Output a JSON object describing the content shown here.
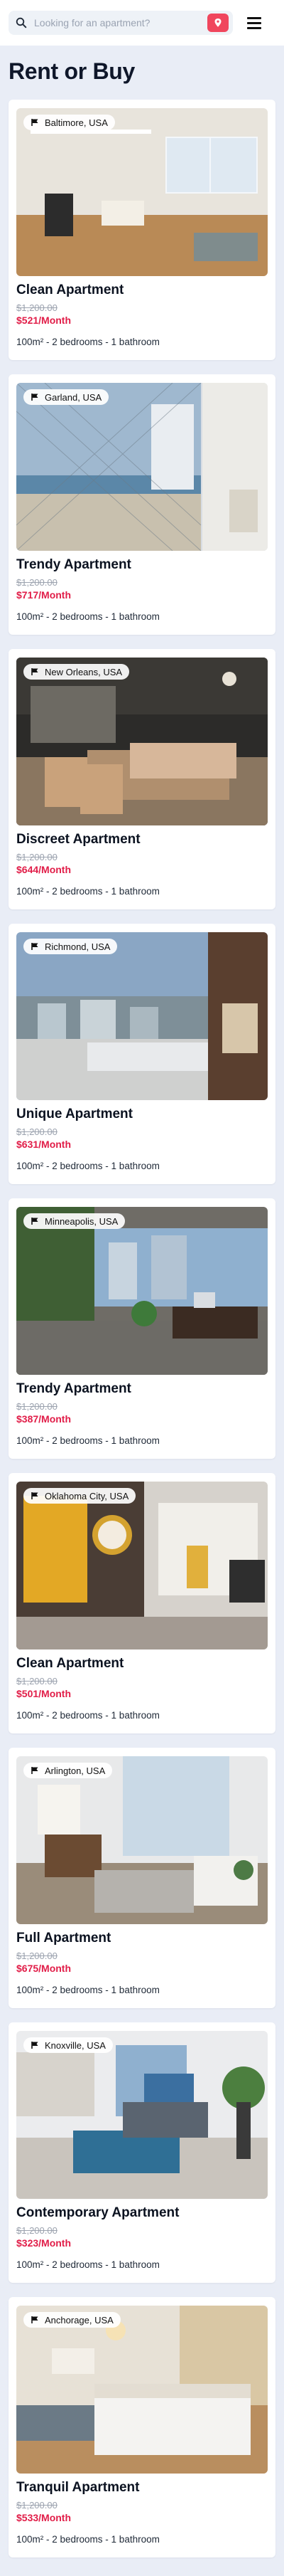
{
  "header": {
    "search_placeholder": "Looking for an apartment?",
    "search_icon": "search-icon",
    "search_button_icon": "pin-icon",
    "menu_icon": "hamburger-menu-icon"
  },
  "page": {
    "title": "Rent or Buy"
  },
  "colors": {
    "accent": "#f0465d",
    "price_new": "#e11d48",
    "price_old": "#9ca3af",
    "background": "#e9edf6"
  },
  "listings": [
    {
      "location": "Baltimore, USA",
      "title": "Clean Apartment",
      "old_price": "$1,200.00",
      "price": "$521/Month",
      "specs": "100m² - 2 bedrooms - 1 bathroom"
    },
    {
      "location": "Garland, USA",
      "title": "Trendy Apartment",
      "old_price": "$1,200.00",
      "price": "$717/Month",
      "specs": "100m² - 2 bedrooms - 1 bathroom"
    },
    {
      "location": "New Orleans, USA",
      "title": "Discreet Apartment",
      "old_price": "$1,200.00",
      "price": "$644/Month",
      "specs": "100m² - 2 bedrooms - 1 bathroom"
    },
    {
      "location": "Richmond, USA",
      "title": "Unique Apartment",
      "old_price": "$1,200.00",
      "price": "$631/Month",
      "specs": "100m² - 2 bedrooms - 1 bathroom"
    },
    {
      "location": "Minneapolis, USA",
      "title": "Trendy Apartment",
      "old_price": "$1,200.00",
      "price": "$387/Month",
      "specs": "100m² - 2 bedrooms - 1 bathroom"
    },
    {
      "location": "Oklahoma City, USA",
      "title": "Clean Apartment",
      "old_price": "$1,200.00",
      "price": "$501/Month",
      "specs": "100m² - 2 bedrooms - 1 bathroom"
    },
    {
      "location": "Arlington, USA",
      "title": "Full Apartment",
      "old_price": "$1,200.00",
      "price": "$675/Month",
      "specs": "100m² - 2 bedrooms - 1 bathroom"
    },
    {
      "location": "Knoxville, USA",
      "title": "Contemporary Apartment",
      "old_price": "$1,200.00",
      "price": "$323/Month",
      "specs": "100m² - 2 bedrooms - 1 bathroom"
    },
    {
      "location": "Anchorage, USA",
      "title": "Tranquil Apartment",
      "old_price": "$1,200.00",
      "price": "$533/Month",
      "specs": "100m² - 2 bedrooms - 1 bathroom"
    }
  ]
}
